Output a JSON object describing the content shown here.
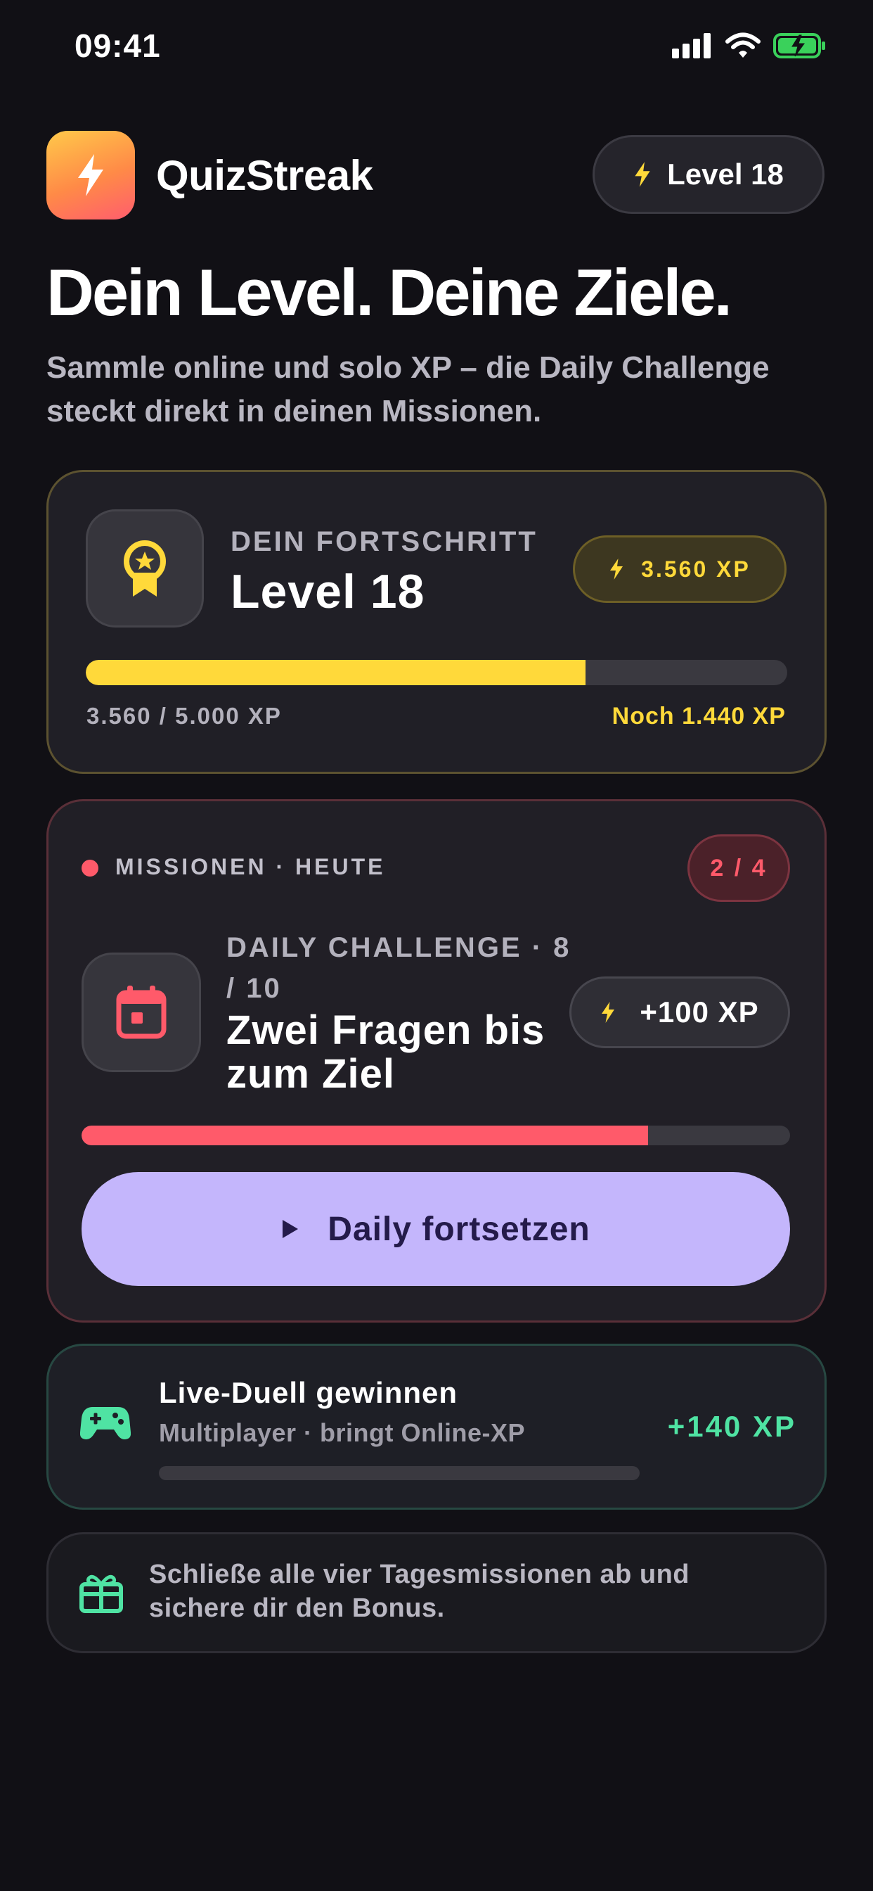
{
  "status_bar": {
    "time": "09:41"
  },
  "header": {
    "app_name": "QuizStreak",
    "level_pill": "Level 18"
  },
  "hero": {
    "headline": "Dein Level. Deine Ziele.",
    "subline": "Sammle online und solo XP – die Daily Challenge steckt direkt in deinen Missionen."
  },
  "progress": {
    "kicker": "DEIN FORTSCHRITT",
    "level": "Level 18",
    "xp_total": "3.560 XP",
    "current_of_max": "3.560 / 5.000 XP",
    "remaining": "Noch 1.440 XP",
    "fraction": 0.712
  },
  "missions": {
    "label": "MISSIONEN · HEUTE",
    "count": "2 / 4",
    "daily": {
      "kicker": "DAILY CHALLENGE · 8 / 10",
      "title": "Zwei Fragen bis zum Ziel",
      "xp": "+100 XP",
      "fraction": 0.8,
      "button_label": "Daily fortsetzen"
    }
  },
  "duel": {
    "title": "Live-Duell gewinnen",
    "subtitle": "Multiplayer · bringt Online-XP",
    "xp": "+140 XP",
    "fraction": 0
  },
  "bonus": {
    "text": "Schließe alle vier Tagesmissionen ab und sichere dir den Bonus."
  },
  "colors": {
    "background": "#111015",
    "accent_yellow": "#ffd93a",
    "accent_red": "#ff5a6a",
    "accent_green": "#4fe3a3",
    "accent_purple": "#c4b6fc"
  },
  "icons": {
    "app": "lightning-bolt-icon",
    "level": "lightning-bolt-icon",
    "progress_badge": "award-medal-icon",
    "daily": "calendar-icon",
    "duel": "gamepad-icon",
    "bonus": "gift-icon",
    "button": "play-icon"
  }
}
